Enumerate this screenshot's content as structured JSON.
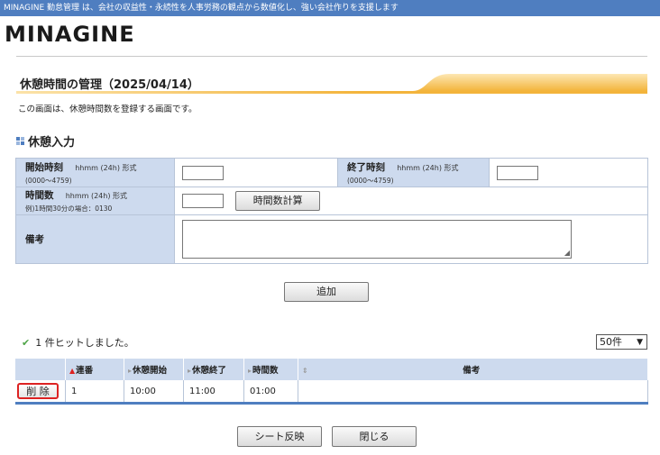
{
  "topbar": {
    "text": "MINAGINE 勤怠管理 は、会社の収益性・永続性を人事労務の観点から数値化し、強い会社作りを支援します"
  },
  "logo": {
    "text": "MINAGINE"
  },
  "page": {
    "title": "休憩時間の管理（2025/04/14）",
    "description": "この画面は、休憩時間数を登録する画面です。",
    "section_title": "休憩入力"
  },
  "form": {
    "start_label": "開始時刻",
    "start_format": "hhmm (24h) 形式",
    "start_range": "(0000～4759)",
    "start_value": "",
    "end_label": "終了時刻",
    "end_format": "hhmm (24h) 形式",
    "end_range": "(0000～4759)",
    "end_value": "",
    "hours_label": "時間数",
    "hours_format": "hhmm (24h) 形式",
    "hours_example": "例)1時間30分の場合：0130",
    "hours_value": "",
    "calc_button": "時間数計算",
    "note_label": "備考",
    "note_value": ""
  },
  "add_button": "追加",
  "results": {
    "hit_text": "1 件ヒットしました。",
    "per_page": "50件"
  },
  "table": {
    "headers": [
      "連番",
      "休憩開始",
      "休憩終了",
      "時間数",
      "備考"
    ],
    "rows": [
      {
        "delete_label": "削 除",
        "seq": "1",
        "start": "10:00",
        "end": "11:00",
        "hours": "01:00",
        "note": ""
      }
    ]
  },
  "footer": {
    "sheet_button": "シート反映",
    "close_button": "閉じる"
  },
  "colors": {
    "accent": "#4f7ec0",
    "header_bg": "#cddaee",
    "title_bar": "#f3b43b"
  }
}
